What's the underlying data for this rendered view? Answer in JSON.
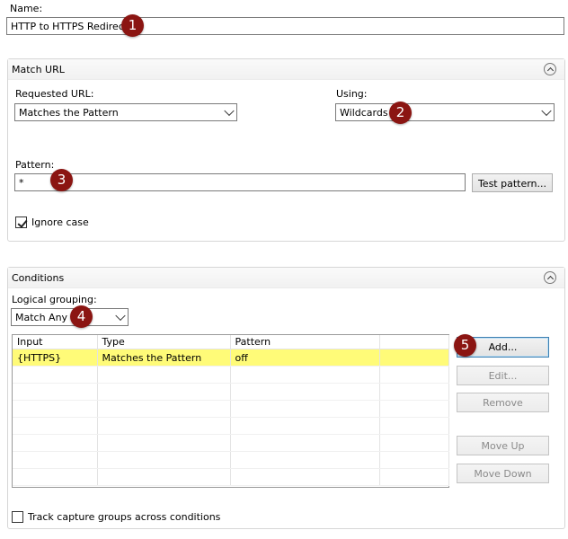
{
  "name": {
    "label": "Name:",
    "value": "HTTP to HTTPS Redirect"
  },
  "match_url": {
    "title": "Match URL",
    "requested_url": {
      "label": "Requested URL:",
      "value": "Matches the Pattern"
    },
    "using": {
      "label": "Using:",
      "value": "Wildcards"
    },
    "pattern": {
      "label": "Pattern:",
      "value": "*"
    },
    "test_pattern_label": "Test pattern...",
    "ignore_case": {
      "label": "Ignore case",
      "checked": true
    }
  },
  "conditions": {
    "title": "Conditions",
    "logical_grouping": {
      "label": "Logical grouping:",
      "value": "Match Any"
    },
    "columns": [
      "Input",
      "Type",
      "Pattern"
    ],
    "rows": [
      {
        "input": "{HTTPS}",
        "type": "Matches the Pattern",
        "pattern": "off"
      }
    ],
    "buttons": {
      "add": "Add...",
      "edit": "Edit...",
      "remove": "Remove",
      "move_up": "Move Up",
      "move_down": "Move Down"
    },
    "track_capture": {
      "label": "Track capture groups across conditions",
      "checked": false
    }
  },
  "callouts": [
    "1",
    "2",
    "3",
    "4",
    "5"
  ],
  "colors": {
    "highlight": "#fffb78",
    "callout": "#8b1512",
    "focus_border": "#3c7fb1"
  },
  "icons": [
    "collapse-icon",
    "chevron-down-icon",
    "checkmark-icon"
  ]
}
